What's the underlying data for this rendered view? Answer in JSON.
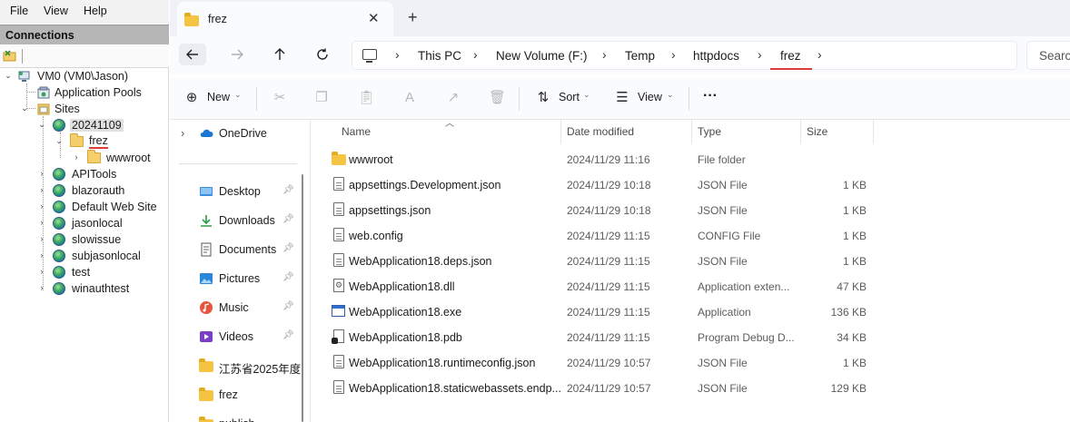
{
  "iis": {
    "menu": [
      "File",
      "View",
      "Help"
    ],
    "connections_title": "Connections",
    "tree": [
      {
        "label": "VM0 (VM0\\Jason)",
        "icon": "server-icon",
        "expanded": true
      },
      {
        "label": "Application Pools",
        "icon": "app-pools-icon"
      },
      {
        "label": "Sites",
        "icon": "sites-icon",
        "expanded": true
      },
      {
        "label": "20241109",
        "icon": "globe-icon",
        "expanded": true,
        "selected": true
      },
      {
        "label": "frez",
        "icon": "folder-icon",
        "expanded": true
      },
      {
        "label": "wwwroot",
        "icon": "folder-icon"
      },
      {
        "label": "APITools",
        "icon": "globe-icon"
      },
      {
        "label": "blazorauth",
        "icon": "globe-icon"
      },
      {
        "label": "Default Web Site",
        "icon": "globe-icon"
      },
      {
        "label": "jasonlocal",
        "icon": "globe-icon"
      },
      {
        "label": "slowissue",
        "icon": "globe-icon"
      },
      {
        "label": "subjasonlocal",
        "icon": "globe-icon"
      },
      {
        "label": "test",
        "icon": "globe-icon"
      },
      {
        "label": "winauthtest",
        "icon": "globe-icon"
      }
    ]
  },
  "explorer": {
    "tab_title": "frez",
    "tab_close": "✕",
    "new_tab": "+",
    "breadcrumb": [
      "This PC",
      "New Volume (F:)",
      "Temp",
      "httpdocs",
      "frez"
    ],
    "search_placeholder": "Searc",
    "commands": {
      "new": "New",
      "sort": "Sort",
      "view": "View",
      "more": "···"
    },
    "nav_pane": [
      {
        "label": "OneDrive",
        "icon": "cloud-icon",
        "pinned": false
      },
      {
        "label": "Desktop",
        "icon": "desktop-icon",
        "pinned": true
      },
      {
        "label": "Downloads",
        "icon": "download-icon",
        "pinned": true
      },
      {
        "label": "Documents",
        "icon": "documents-icon",
        "pinned": true
      },
      {
        "label": "Pictures",
        "icon": "pictures-icon",
        "pinned": true
      },
      {
        "label": "Music",
        "icon": "music-icon",
        "pinned": true
      },
      {
        "label": "Videos",
        "icon": "videos-icon",
        "pinned": true
      },
      {
        "label": "江苏省2025年度",
        "icon": "folder-icon",
        "pinned": false
      },
      {
        "label": "frez",
        "icon": "folder-icon",
        "pinned": false
      },
      {
        "label": "publish",
        "icon": "folder-icon",
        "pinned": false
      }
    ],
    "columns": {
      "name": "Name",
      "date": "Date modified",
      "type": "Type",
      "size": "Size"
    },
    "files": [
      {
        "name": "wwwroot",
        "date": "2024/11/29 11:16",
        "type": "File folder",
        "size": "",
        "icon": "folder-icon"
      },
      {
        "name": "appsettings.Development.json",
        "date": "2024/11/29 10:18",
        "type": "JSON File",
        "size": "1 KB",
        "icon": "json-file-icon"
      },
      {
        "name": "appsettings.json",
        "date": "2024/11/29 10:18",
        "type": "JSON File",
        "size": "1 KB",
        "icon": "json-file-icon"
      },
      {
        "name": "web.config",
        "date": "2024/11/29 11:15",
        "type": "CONFIG File",
        "size": "1 KB",
        "icon": "config-file-icon"
      },
      {
        "name": "WebApplication18.deps.json",
        "date": "2024/11/29 11:15",
        "type": "JSON File",
        "size": "1 KB",
        "icon": "json-file-icon"
      },
      {
        "name": "WebApplication18.dll",
        "date": "2024/11/29 11:15",
        "type": "Application exten...",
        "size": "47 KB",
        "icon": "dll-file-icon"
      },
      {
        "name": "WebApplication18.exe",
        "date": "2024/11/29 11:15",
        "type": "Application",
        "size": "136 KB",
        "icon": "exe-file-icon"
      },
      {
        "name": "WebApplication18.pdb",
        "date": "2024/11/29 11:15",
        "type": "Program Debug D...",
        "size": "34 KB",
        "icon": "pdb-file-icon"
      },
      {
        "name": "WebApplication18.runtimeconfig.json",
        "date": "2024/11/29 10:57",
        "type": "JSON File",
        "size": "1 KB",
        "icon": "json-file-icon"
      },
      {
        "name": "WebApplication18.staticwebassets.endp...",
        "date": "2024/11/29 10:57",
        "type": "JSON File",
        "size": "129 KB",
        "icon": "json-file-icon"
      }
    ]
  },
  "colors": {
    "accent_underline": "#e13a3a",
    "folder": "#f5c443",
    "selection": "#e0e0e0"
  }
}
